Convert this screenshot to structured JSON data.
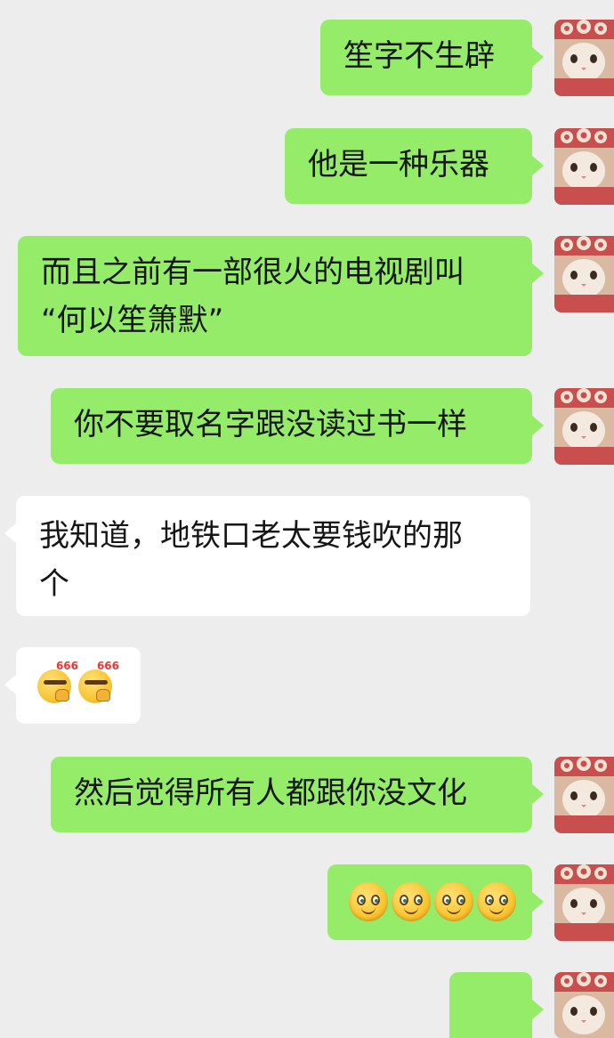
{
  "messages": [
    {
      "side": "out",
      "text": "笙字不生辟"
    },
    {
      "side": "out",
      "text": "他是一种乐器"
    },
    {
      "side": "out",
      "lines": [
        "而且之前有一部很火的电视剧叫",
        "“何以笙箫默”"
      ]
    },
    {
      "side": "out",
      "text": "你不要取名字跟没读过书一样"
    },
    {
      "side": "in",
      "lines": [
        "我知道，地铁口老太要钱吹的那",
        "个"
      ]
    },
    {
      "side": "in",
      "emoji": "666-smirk-emoji",
      "count": 2,
      "emoji_label": "666"
    },
    {
      "side": "out",
      "text": "然后觉得所有人都跟你没文化"
    },
    {
      "side": "out",
      "emoji": "money-eyes-emoji",
      "count": 4
    },
    {
      "side": "out",
      "text": ""
    }
  ],
  "colors": {
    "background": "#ededed",
    "outgoing_bubble": "#95ec69",
    "incoming_bubble": "#ffffff"
  },
  "avatar": {
    "icon": "cat-avatar-icon"
  }
}
